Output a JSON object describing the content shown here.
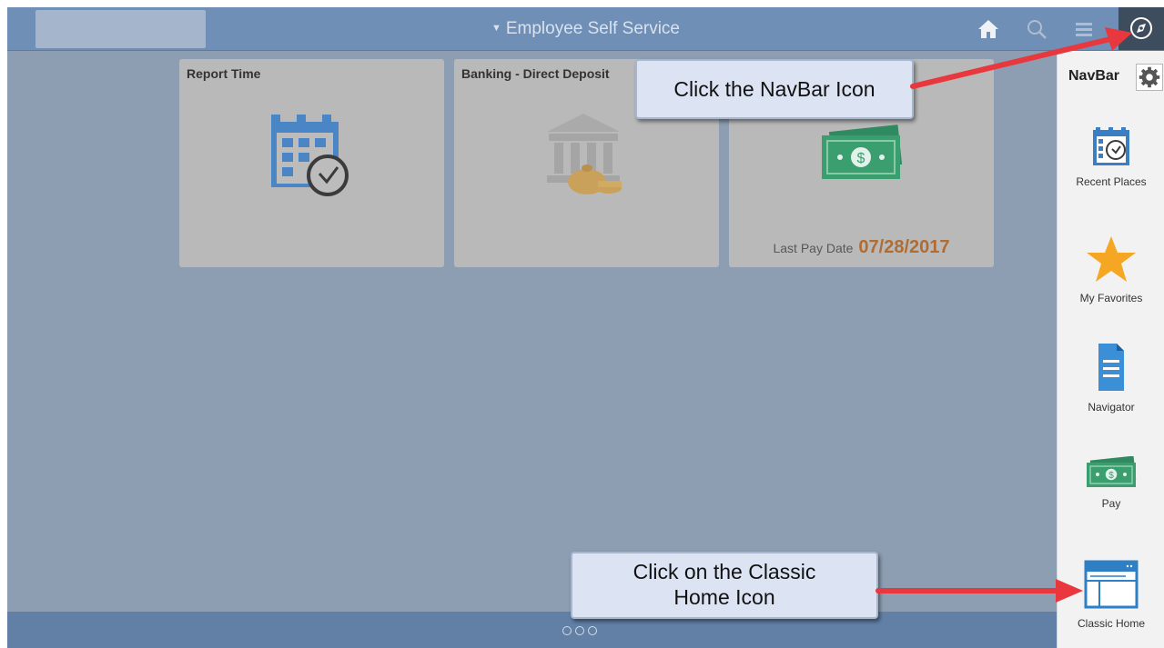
{
  "header": {
    "app_title": "Employee Self Service",
    "title_caret": "▼"
  },
  "tiles": [
    {
      "title": "Report Time",
      "icon": "calendar-clock-icon"
    },
    {
      "title": "Banking - Direct Deposit",
      "icon": "bank-icon"
    },
    {
      "title": "",
      "icon": "money-icon",
      "pay_label": "Last Pay Date",
      "pay_date": "07/28/2017"
    }
  ],
  "navbar": {
    "title": "NavBar",
    "items": [
      {
        "label": "Recent Places",
        "icon": "recent-places-icon"
      },
      {
        "label": "My Favorites",
        "icon": "star-icon"
      },
      {
        "label": "Navigator",
        "icon": "document-icon"
      },
      {
        "label": "Pay",
        "icon": "money-icon"
      },
      {
        "label": "Classic Home",
        "icon": "classic-home-icon"
      }
    ]
  },
  "pagination": {
    "count": 3
  },
  "callouts": {
    "navbar_hint": "Click the NavBar Icon",
    "classic_line1": "Click on the Classic",
    "classic_line2": "Home Icon"
  },
  "colors": {
    "header": "#6f8fb6",
    "main_bg": "#8d9eb2",
    "tile_bg": "#b9b9b9",
    "pay_date": "#b16c32",
    "arrow": "#e8383d",
    "callout_bg": "#dce4f3"
  }
}
